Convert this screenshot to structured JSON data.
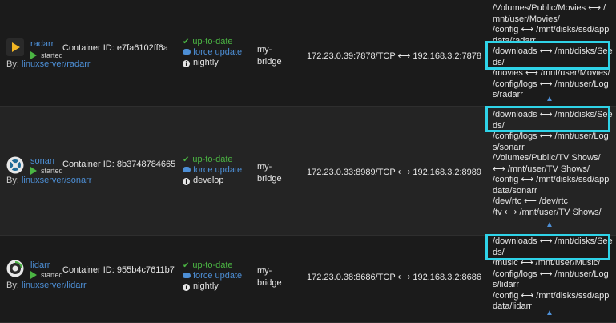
{
  "containers": [
    {
      "name": "radarr",
      "icon": "radarr-play-icon",
      "state": "started",
      "by_prefix": "By:",
      "author": "linuxserver/radarr",
      "container_id": "Container ID: e7fa6102ff6a",
      "update_status": "up-to-date",
      "force_update": "force update",
      "tag": "nightly",
      "network": "my-bridge",
      "ports": "172.23.0.39:7878/TCP ⟷ 192.168.3.2:7878",
      "volumes": [
        "/Volumes/Public/Movies ⟷ /mnt/user/Movies/",
        "/config ⟷ /mnt/disks/ssd/appdata/radarr",
        "/downloads ⟷ /mnt/disks/Seeds/",
        "/movies ⟷ /mnt/user/Movies/",
        "/config/logs ⟷ /mnt/user/Logs/radarr"
      ]
    },
    {
      "name": "sonarr",
      "icon": "sonarr-icon",
      "state": "started",
      "by_prefix": "By:",
      "author": "linuxserver/sonarr",
      "container_id": "Container ID: 8b3748784665",
      "update_status": "up-to-date",
      "force_update": "force update",
      "tag": "develop",
      "network": "my-bridge",
      "ports": "172.23.0.33:8989/TCP ⟷ 192.168.3.2:8989",
      "volumes": [
        "/downloads ⟷ /mnt/disks/Seeds/",
        "/config/logs ⟷ /mnt/user/Logs/sonarr",
        "/Volumes/Public/TV Shows/ ⟷ /mnt/user/TV Shows/",
        "/config ⟷ /mnt/disks/ssd/appdata/sonarr",
        "/dev/rtc ⟵ /dev/rtc",
        "/tv ⟷ /mnt/user/TV Shows/"
      ]
    },
    {
      "name": "lidarr",
      "icon": "lidarr-icon",
      "state": "started",
      "by_prefix": "By:",
      "author": "linuxserver/lidarr",
      "container_id": "Container ID: 955b4c7611b7",
      "update_status": "up-to-date",
      "force_update": "force update",
      "tag": "nightly",
      "network": "my-bridge",
      "ports": "172.23.0.38:8686/TCP ⟷ 192.168.3.2:8686",
      "volumes": [
        "/downloads ⟷ /mnt/disks/Seeds/",
        "/music ⟷ /mnt/user/Music/",
        "/config/logs ⟷ /mnt/user/Logs/lidarr",
        "/config ⟷ /mnt/disks/ssd/appdata/lidarr"
      ]
    }
  ],
  "colors": {
    "accent": "#4d8fd6",
    "ok": "#4bb543",
    "highlight": "#2fd3e8"
  }
}
